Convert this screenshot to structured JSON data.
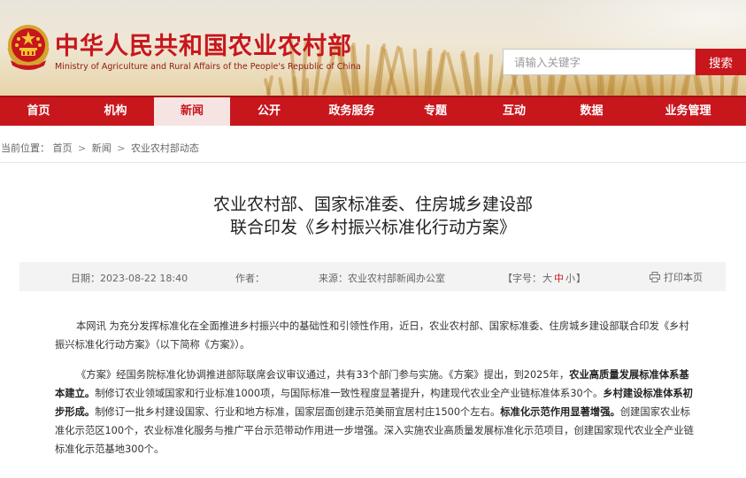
{
  "header": {
    "title_cn": "中华人民共和国农业农村部",
    "title_en": "Ministry of Agriculture and Rural Affairs of the People's Republic of China",
    "search_placeholder": "请输入关键字",
    "search_button": "搜索"
  },
  "nav": {
    "items": [
      {
        "label": "首页"
      },
      {
        "label": "机构"
      },
      {
        "label": "新闻"
      },
      {
        "label": "公开"
      },
      {
        "label": "政务服务"
      },
      {
        "label": "专题"
      },
      {
        "label": "互动"
      },
      {
        "label": "数据"
      },
      {
        "label": "业务管理"
      }
    ],
    "active": "新闻"
  },
  "breadcrumb": {
    "prefix": "当前位置：",
    "items": [
      "首页",
      "新闻",
      "农业农村部动态"
    ],
    "separator": ">"
  },
  "article": {
    "title_line1": "农业农村部、国家标准委、住房城乡建设部",
    "title_line2": "联合印发《乡村振兴标准化行动方案》",
    "meta": {
      "date_label": "日期：",
      "date": "2023-08-22 18:40",
      "author_label": "作者：",
      "author": "",
      "source_label": "来源：",
      "source": "农业农村部新闻办公室",
      "fontsize_prefix": "【字号：",
      "fontsize_big": "大",
      "fontsize_mid": "中",
      "fontsize_small": "小",
      "fontsize_suffix": "】",
      "print_label": "打印本页"
    },
    "p1": "本网讯  为充分发挥标准化在全面推进乡村振兴中的基础性和引领性作用，近日，农业农村部、国家标准委、住房城乡建设部联合印发《乡村振兴标准化行动方案》（以下简称《方案》）。",
    "p2_a": "《方案》经国务院标准化协调推进部际联席会议审议通过，共有33个部门参与实施。《方案》提出，到2025年，",
    "p2_b1": "农业高质量发展标准体系基本建立。",
    "p2_c": "制修订农业领域国家和行业标准1000项，与国际标准一致性程度显著提升，构建现代农业全产业链标准体系30个。",
    "p2_b2": "乡村建设标准体系初步形成。",
    "p2_d": "制修订一批乡村建设国家、行业和地方标准，国家层面创建示范美丽宜居村庄1500个左右。",
    "p2_b3": "标准化示范作用显著增强。",
    "p2_e": "创建国家农业标准化示范区100个，农业标准化服务与推广平台示范带动作用进一步增强。深入实施农业高质量发展标准化示范项目，创建国家现代农业全产业链标准化示范基地300个。"
  },
  "colors": {
    "brand_red": "#c8161d",
    "nav_active_bg": "#f6e4e3",
    "meta_bg": "#f3f3f3"
  },
  "icons": {
    "emblem": "national-emblem",
    "print": "printer-icon"
  }
}
